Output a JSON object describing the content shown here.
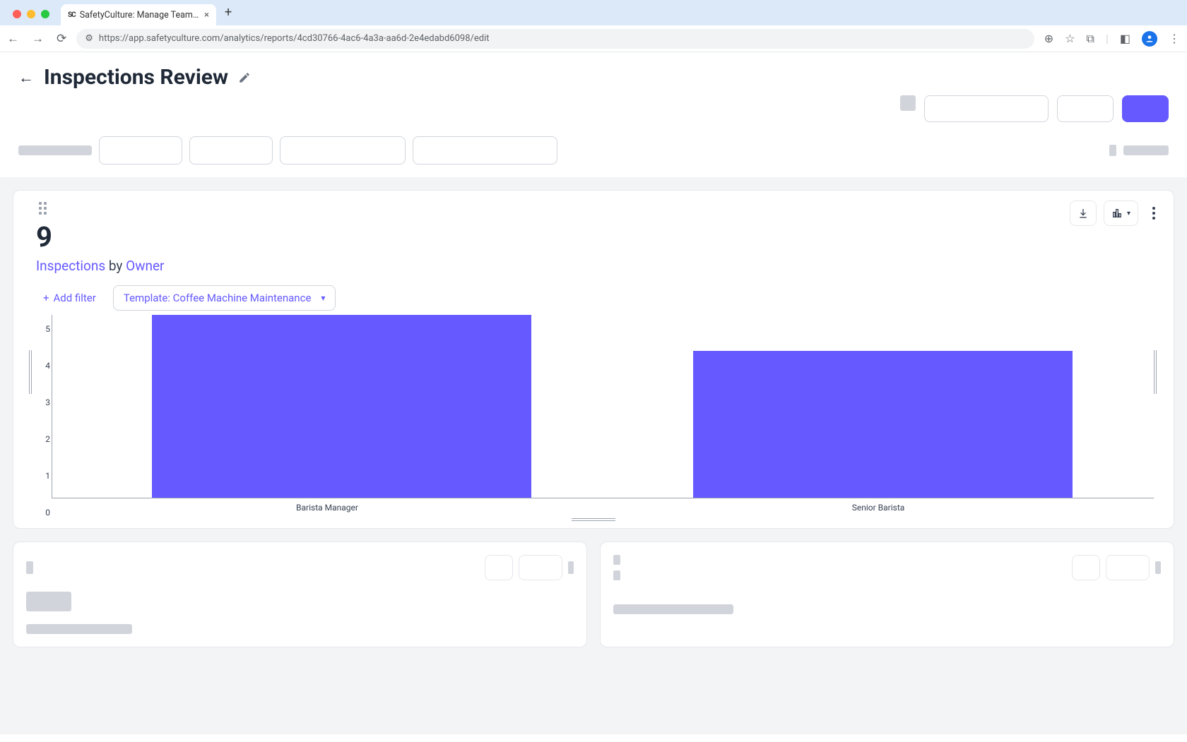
{
  "browser": {
    "tab_title": "SafetyCulture: Manage Teams and...",
    "url": "https://app.safetyculture.com/analytics/reports/4cd30766-4ac6-4a3a-aa6d-2e4edabd6098/edit"
  },
  "page": {
    "title": "Inspections Review"
  },
  "card": {
    "metric_value": "9",
    "subtitle_a": "Inspections",
    "subtitle_joiner": " by ",
    "subtitle_b": "Owner",
    "add_filter_label": "Add filter",
    "template_chip": "Template: Coffee Machine Maintenance"
  },
  "chart_data": {
    "type": "bar",
    "categories": [
      "Barista Manager",
      "Senior Barista"
    ],
    "values": [
      5,
      4
    ],
    "title": "",
    "xlabel": "",
    "ylabel": "",
    "ylim": [
      0,
      5
    ],
    "y_ticks": [
      0,
      1,
      2,
      3,
      4,
      5
    ],
    "color": "#6559ff"
  }
}
